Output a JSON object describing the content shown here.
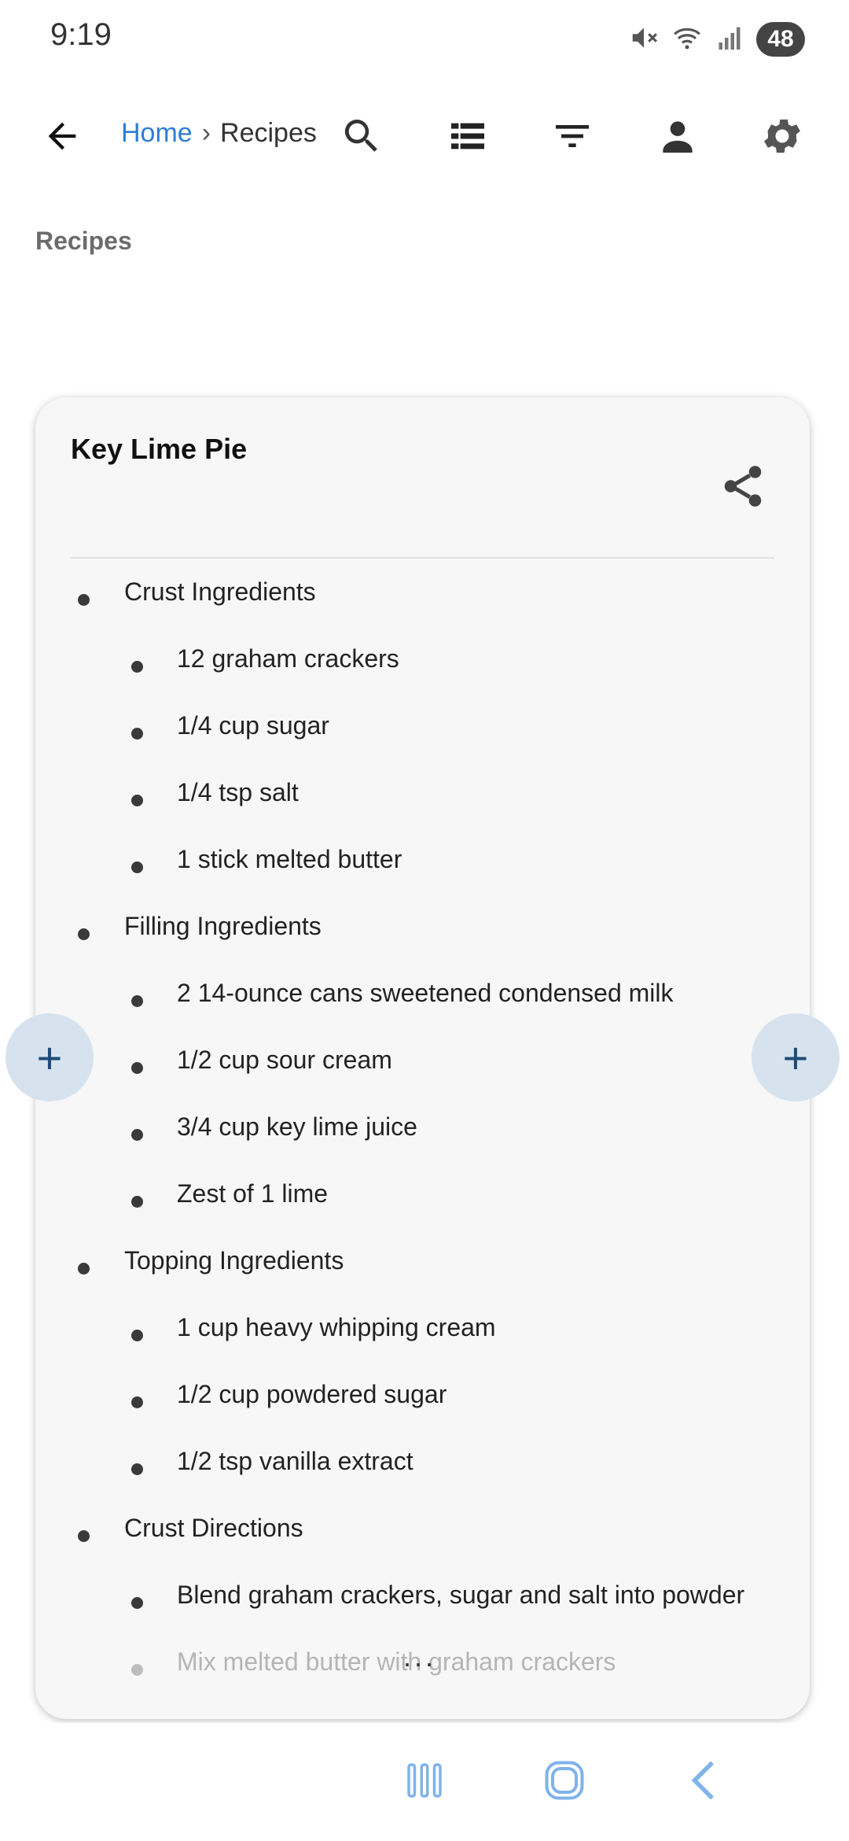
{
  "status": {
    "time": "9:19",
    "battery": "48",
    "icons": [
      "mute-icon",
      "wifi-icon",
      "signal-icon"
    ]
  },
  "topbar": {
    "back_icon": "arrow-left-icon",
    "breadcrumb": {
      "home": "Home",
      "separator": "›",
      "current": "Recipes"
    },
    "icons": [
      "search-icon",
      "list-view-icon",
      "filter-icon",
      "account-icon",
      "settings-icon"
    ]
  },
  "section_title": "Recipes",
  "recipe": {
    "title": "Key Lime Pie",
    "share_icon": "share-icon",
    "items": [
      {
        "level": 1,
        "text": "Crust Ingredients"
      },
      {
        "level": 2,
        "text": "12 graham crackers"
      },
      {
        "level": 2,
        "text": "1/4 cup sugar"
      },
      {
        "level": 2,
        "text": "1/4 tsp salt"
      },
      {
        "level": 2,
        "text": "1 stick melted butter"
      },
      {
        "level": 1,
        "text": "Filling Ingredients"
      },
      {
        "level": 2,
        "text": "2 14-ounce cans sweetened condensed milk"
      },
      {
        "level": 2,
        "text": "1/2 cup sour cream"
      },
      {
        "level": 2,
        "text": "3/4 cup key lime juice"
      },
      {
        "level": 2,
        "text": "Zest of 1 lime"
      },
      {
        "level": 1,
        "text": "Topping Ingredients"
      },
      {
        "level": 2,
        "text": "1 cup heavy whipping cream"
      },
      {
        "level": 2,
        "text": "1/2 cup powdered sugar"
      },
      {
        "level": 2,
        "text": "1/2 tsp vanilla extract"
      },
      {
        "level": 1,
        "text": "Crust Directions"
      },
      {
        "level": 2,
        "text": "Blend graham crackers, sugar and salt into powder"
      },
      {
        "level": 2,
        "text": "Mix melted butter with graham crackers"
      }
    ],
    "more_indicator": "..."
  },
  "fab": {
    "label": "+"
  },
  "navbar": {
    "icons": [
      "recent-apps-icon",
      "home-icon",
      "back-icon"
    ]
  },
  "colors": {
    "accent": "#2e7dd6",
    "fab_bg": "#d6e3ef",
    "fab_fg": "#1f4c76",
    "nav_icon": "#7fb3ea"
  }
}
